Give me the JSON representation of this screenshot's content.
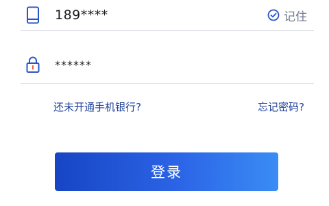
{
  "phone": {
    "value": "189****",
    "icon": "phone-icon"
  },
  "remember": {
    "label": "记住",
    "checked": true,
    "icon": "check-circle-icon"
  },
  "password": {
    "value": "******",
    "icon": "lock-icon"
  },
  "links": {
    "open_account": "还未开通手机银行?",
    "forgot_password": "忘记密码?"
  },
  "login_button": {
    "label": "登录"
  },
  "colors": {
    "icon_blue": "#2a55c9",
    "link": "#1d3f9a",
    "button_start": "#1745c4",
    "button_end": "#3a8cf5"
  }
}
